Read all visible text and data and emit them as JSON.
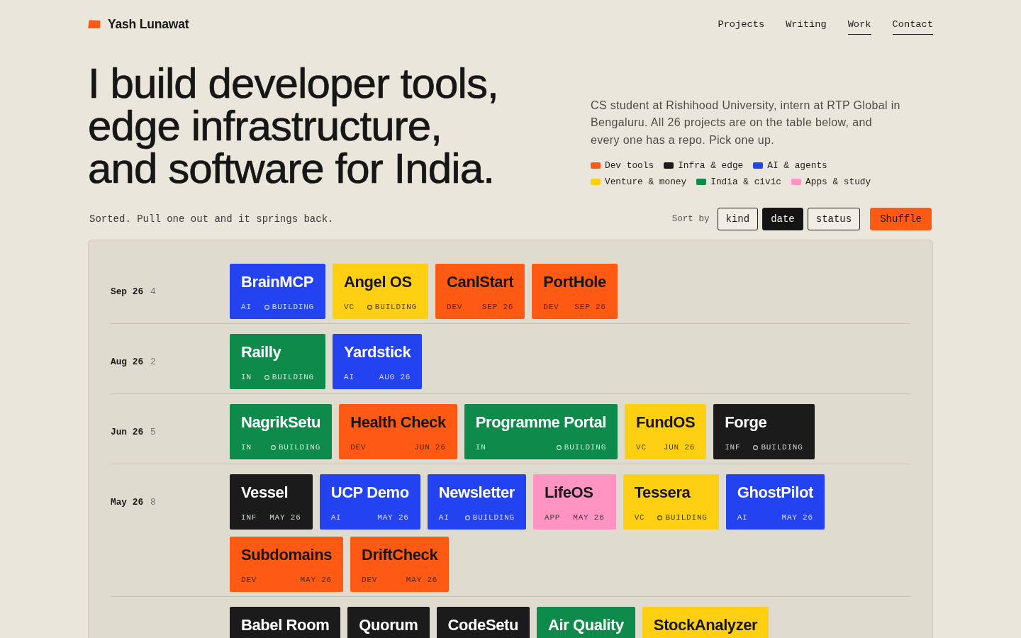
{
  "header": {
    "name": "Yash Lunawat",
    "nav": [
      {
        "label": "Projects",
        "underlined": false
      },
      {
        "label": "Writing",
        "underlined": false
      },
      {
        "label": "Work",
        "underlined": true
      },
      {
        "label": "Contact",
        "underlined": true
      }
    ]
  },
  "hero": {
    "headline": "I build developer tools,\nedge infrastructure,\nand software for India.",
    "intro": "CS student at Rishihood University, intern at RTP Global in Bengaluru. All 26 projects are on the table below, and every one has a repo. Pick one up.",
    "legend": [
      {
        "label": "Dev tools",
        "color": "#ff5a14"
      },
      {
        "label": "Infra & edge",
        "color": "#1b1b1b"
      },
      {
        "label": "AI & agents",
        "color": "#2443f0"
      },
      {
        "label": "Venture & money",
        "color": "#ffd012"
      },
      {
        "label": "India & civic",
        "color": "#0e8a4a"
      },
      {
        "label": "Apps & study",
        "color": "#ff94c2"
      }
    ]
  },
  "toolbar": {
    "hint": "Sorted. Pull one out and it springs back.",
    "sort_label": "Sort by",
    "sort_options": [
      {
        "label": "kind",
        "selected": false
      },
      {
        "label": "date",
        "selected": true
      },
      {
        "label": "status",
        "selected": false
      }
    ],
    "shuffle": "Shuffle"
  },
  "board": {
    "groups": [
      {
        "label": "Sep 26",
        "count": "4",
        "tiles": [
          {
            "title": "BrainMCP",
            "tag": "AI",
            "status": "BUILDING",
            "color": "#2443f0"
          },
          {
            "title": "Angel OS",
            "tag": "VC",
            "status": "BUILDING",
            "color": "#ffd012"
          },
          {
            "title": "CanlStart",
            "tag": "DEV",
            "date": "SEP 26",
            "color": "#ff5a14"
          },
          {
            "title": "PortHole",
            "tag": "DEV",
            "date": "SEP 26",
            "color": "#ff5a14"
          }
        ]
      },
      {
        "label": "Aug 26",
        "count": "2",
        "tiles": [
          {
            "title": "Railly",
            "tag": "IN",
            "status": "BUILDING",
            "color": "#0e8a4a"
          },
          {
            "title": "Yardstick",
            "tag": "AI",
            "date": "AUG 26",
            "color": "#2443f0"
          }
        ]
      },
      {
        "label": "Jun 26",
        "count": "5",
        "tiles": [
          {
            "title": "NagrikSetu",
            "tag": "IN",
            "status": "BUILDING",
            "color": "#0e8a4a"
          },
          {
            "title": "Health Check",
            "tag": "DEV",
            "date": "JUN 26",
            "color": "#ff5a14"
          },
          {
            "title": "Programme Portal",
            "tag": "IN",
            "status": "BUILDING",
            "color": "#0e8a4a"
          },
          {
            "title": "FundOS",
            "tag": "VC",
            "date": "JUN 26",
            "color": "#ffd012"
          },
          {
            "title": "Forge",
            "tag": "INF",
            "status": "BUILDING",
            "color": "#1b1b1b"
          }
        ]
      },
      {
        "label": "May 26",
        "count": "8",
        "tiles": [
          {
            "title": "Vessel",
            "tag": "INF",
            "date": "MAY 26",
            "color": "#1b1b1b"
          },
          {
            "title": "UCP Demo",
            "tag": "AI",
            "date": "MAY 26",
            "color": "#2443f0"
          },
          {
            "title": "Newsletter",
            "tag": "AI",
            "status": "BUILDING",
            "color": "#2443f0"
          },
          {
            "title": "LifeOS",
            "tag": "APP",
            "date": "MAY 26",
            "color": "#ff94c2"
          },
          {
            "title": "Tessera",
            "tag": "VC",
            "status": "BUILDING",
            "color": "#ffd012"
          },
          {
            "title": "GhostPilot",
            "tag": "AI",
            "date": "MAY 26",
            "color": "#2443f0"
          },
          {
            "title": "Subdomains",
            "tag": "DEV",
            "date": "MAY 26",
            "color": "#ff5a14"
          },
          {
            "title": "DriftCheck",
            "tag": "DEV",
            "date": "MAY 26",
            "color": "#ff5a14"
          }
        ]
      },
      {
        "tiles": [
          {
            "title": "Babel Room",
            "color": "#1b1b1b"
          },
          {
            "title": "Quorum",
            "color": "#1b1b1b"
          },
          {
            "title": "CodeSetu",
            "color": "#1b1b1b"
          },
          {
            "title": "Air Quality",
            "color": "#0e8a4a"
          },
          {
            "title": "StockAnalyzer",
            "color": "#ffd012"
          }
        ]
      }
    ]
  }
}
